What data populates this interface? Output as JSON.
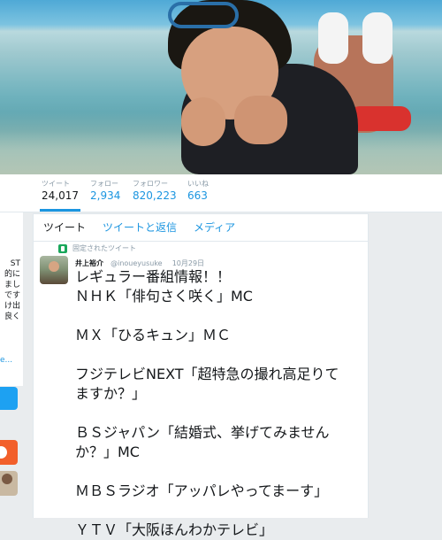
{
  "stats": [
    {
      "label": "ツイート",
      "value": "24,017",
      "active": true
    },
    {
      "label": "フォロー",
      "value": "2,934",
      "active": false
    },
    {
      "label": "フォロワー",
      "value": "820,223",
      "active": false
    },
    {
      "label": "いいね",
      "value": "663",
      "active": false
    }
  ],
  "left_sidebar": {
    "text_lines": [
      "ST",
      "的に",
      "まし",
      "です",
      "け出",
      "良く"
    ],
    "more_link": "e..."
  },
  "tabs": [
    {
      "label": "ツイート",
      "active": true
    },
    {
      "label": "ツイートと返信",
      "active": false
    },
    {
      "label": "メディア",
      "active": false
    }
  ],
  "pinned": {
    "label": "固定されたツイート"
  },
  "tweet": {
    "name": "井上裕介",
    "handle": "@inoueyusuke",
    "date": "10月29日",
    "lines": [
      "レギュラー番組情報！！",
      "ＮＨＫ「俳句さく咲く」MC",
      "",
      "ＭＸ「ひるキュン」ＭＣ",
      "",
      "フジテレビNEXT「超特急の撮れ高足りて",
      "ますか？」",
      "",
      "ＢＳジャパン「結婚式、挙げてみません",
      "か？」MC",
      "",
      "ＭＢＳラジオ「アッパレやってまーす」",
      "",
      "ＹＴＶ「大阪ほんわかテレビ」"
    ]
  },
  "colors": {
    "accent": "#1b95e0",
    "pin": "#19a75b",
    "muted": "#8899a6"
  }
}
